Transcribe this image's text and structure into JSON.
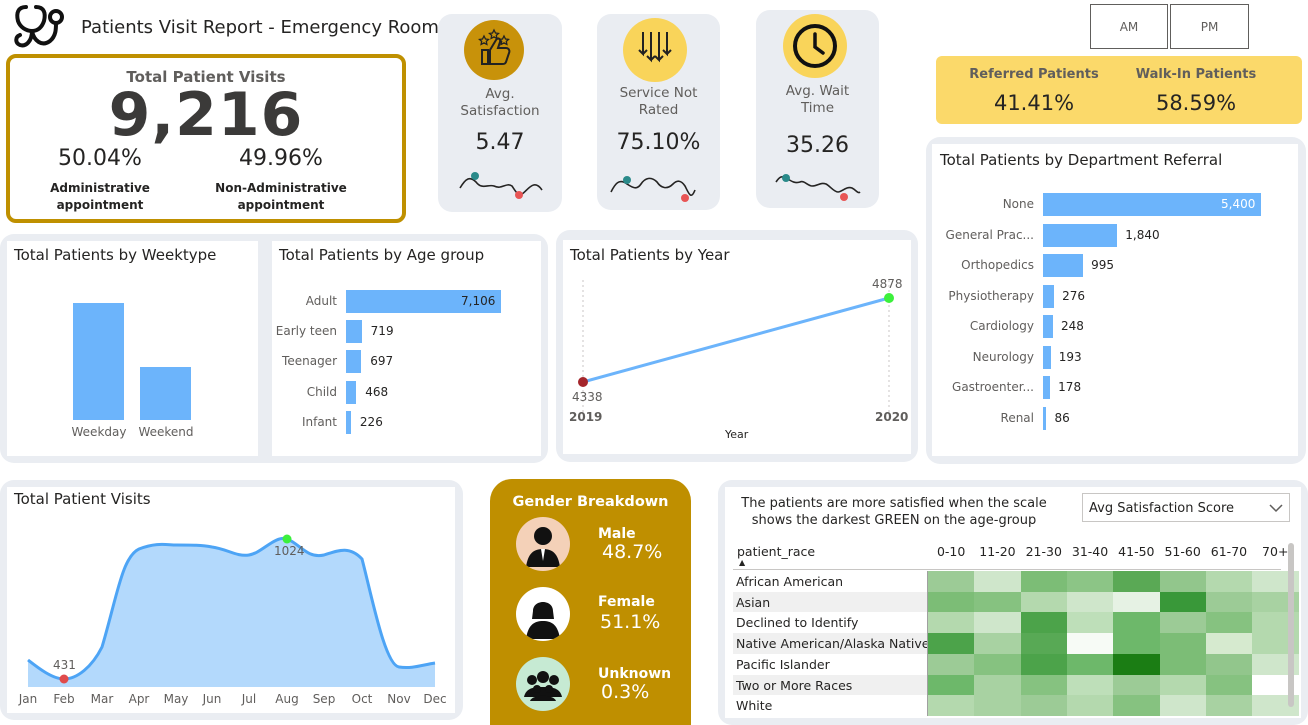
{
  "header": {
    "title": "Patients Visit Report - Emergency Room",
    "logo_icon": "stethoscope-icon"
  },
  "total_visits": {
    "title": "Total Patient Visits",
    "value": "9,216",
    "admin_pct": "50.04%",
    "admin_label_1": "Administrative",
    "admin_label_2": "appointment",
    "nonadmin_pct": "49.96%",
    "nonadmin_label_1": "Non-Administrative",
    "nonadmin_label_2": "appointment"
  },
  "kpis": [
    {
      "label_1": "Avg.",
      "label_2": "Satisfaction",
      "value": "5.47",
      "icon": "thumbs-up-stars-icon",
      "color": "#c8920a"
    },
    {
      "label_1": "Service Not",
      "label_2": "Rated",
      "value": "75.10%",
      "icon": "down-arrows-icon",
      "color": "#f9d45a"
    },
    {
      "label_1": "Avg. Wait",
      "label_2": "Time",
      "value": "35.26",
      "icon": "clock-icon",
      "color": "#f9d45a"
    }
  ],
  "ampm": {
    "am": "AM",
    "pm": "PM"
  },
  "referral": {
    "referred_label": "Referred Patients",
    "referred_value": "41.41%",
    "walkin_label": "Walk-In Patients",
    "walkin_value": "58.59%",
    "bg": "#fbd96a"
  },
  "weektype": {
    "title": "Total Patients by Weektype",
    "categories": [
      "Weekday",
      "Weekend"
    ],
    "values": [
      6300,
      2916
    ]
  },
  "age": {
    "title": "Total Patients by Age group",
    "rows": [
      {
        "label": "Adult",
        "value": "7,106",
        "n": 7106
      },
      {
        "label": "Early teen",
        "value": "719",
        "n": 719
      },
      {
        "label": "Teenager",
        "value": "697",
        "n": 697
      },
      {
        "label": "Child",
        "value": "468",
        "n": 468
      },
      {
        "label": "Infant",
        "value": "226",
        "n": 226
      }
    ]
  },
  "year": {
    "title": "Total Patients by Year",
    "x_label": "Year",
    "start_year": "2019",
    "end_year": "2020",
    "start_value": "4338",
    "end_value": "4878"
  },
  "dept": {
    "title": "Total Patients by Department Referral",
    "rows": [
      {
        "label": "None",
        "value": "5,400",
        "n": 5400
      },
      {
        "label": "General Prac...",
        "value": "1,840",
        "n": 1840
      },
      {
        "label": "Orthopedics",
        "value": "995",
        "n": 995
      },
      {
        "label": "Physiotherapy",
        "value": "276",
        "n": 276
      },
      {
        "label": "Cardiology",
        "value": "248",
        "n": 248
      },
      {
        "label": "Neurology",
        "value": "193",
        "n": 193
      },
      {
        "label": "Gastroenter...",
        "value": "178",
        "n": 178
      },
      {
        "label": "Renal",
        "value": "86",
        "n": 86
      }
    ]
  },
  "monthly": {
    "title": "Total Patient Visits",
    "min_label": "431",
    "max_label": "1024",
    "months": [
      "Jan",
      "Feb",
      "Mar",
      "Apr",
      "May",
      "Jun",
      "Jul",
      "Aug",
      "Sep",
      "Oct",
      "Nov",
      "Dec"
    ]
  },
  "gender": {
    "title": "Gender Breakdown",
    "bg": "#bf8f00",
    "rows": [
      {
        "label": "Male",
        "value": "48.7%",
        "icon": "male-user-icon"
      },
      {
        "label": "Female",
        "value": "51.1%",
        "icon": "female-user-icon"
      },
      {
        "label": "Unknown",
        "value": "0.3%",
        "icon": "group-icon"
      }
    ]
  },
  "heatmap": {
    "note_1": "The patients are more satisfied when the scale",
    "note_2": "shows the darkest GREEN on the age-group",
    "dropdown": "Avg Satisfaction Score",
    "row_header": "patient_race",
    "cols": [
      "0-10",
      "11-20",
      "21-30",
      "31-40",
      "41-50",
      "51-60",
      "61-70",
      "70+"
    ],
    "rows": [
      "African American",
      "Asian",
      "Declined to Identify",
      "Native American/Alaska Native",
      "Pacific Islander",
      "Two or More Races",
      "White"
    ],
    "colors": [
      [
        "#9ccb96",
        "#cfe6cb",
        "#7cbd76",
        "#8cc586",
        "#5aa955",
        "#92c68c",
        "#b4d9ae",
        "#cfe6cb"
      ],
      [
        "#7cbd76",
        "#86c280",
        "#b4d9ae",
        "#cfe6cb",
        "#e6f2e4",
        "#399839",
        "#9ccb96",
        "#a8d2a2"
      ],
      [
        "#b4d9ae",
        "#cfe6cb",
        "#4ca34a",
        "#bedfb9",
        "#6db86a",
        "#9ccb96",
        "#86c280",
        "#b4d9ae"
      ],
      [
        "#4ca34a",
        "#a8d2a2",
        "#58a955",
        "#f7fbf6",
        "#6db86a",
        "#7cbd76",
        "#d6eacf",
        "#b4d9ae"
      ],
      [
        "#9ccb96",
        "#86c280",
        "#4ca34a",
        "#6db86a",
        "#1b7d14",
        "#7cbd76",
        "#92c68c",
        "#cfe6cb"
      ],
      [
        "#6db86a",
        "#a8d2a2",
        "#86c280",
        "#bedfb9",
        "#9ccb96",
        "#b4d9ae",
        "#86c280",
        "#ffffff"
      ],
      [
        "#b4d9ae",
        "#a8d2a2",
        "#9ccb96",
        "#b4d9ae",
        "#86c280",
        "#cfe6cb",
        "#a8d2a2",
        "#cfe6cb"
      ]
    ]
  }
}
